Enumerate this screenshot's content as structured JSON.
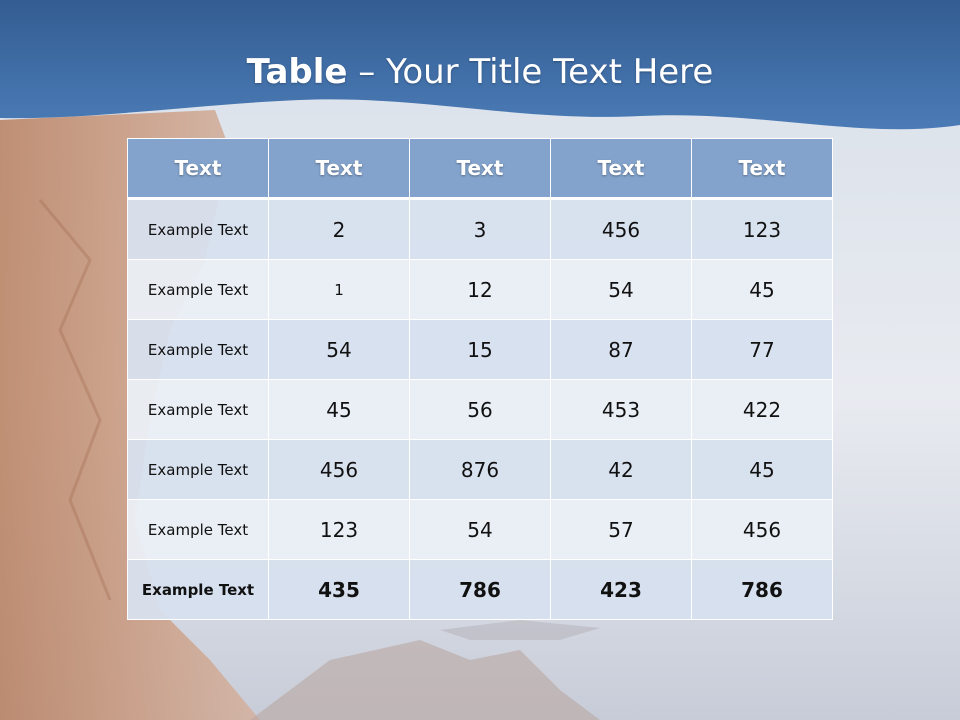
{
  "slide": {
    "title_bold": "Table",
    "title_rest": " – Your Title Text Here"
  },
  "table": {
    "headers": [
      "Text",
      "Text",
      "Text",
      "Text",
      "Text"
    ],
    "rows": [
      [
        "Example Text",
        "2",
        "3",
        "456",
        "123"
      ],
      [
        "Example Text",
        "1",
        "12",
        "54",
        "45"
      ],
      [
        "Example Text",
        "54",
        "15",
        "87",
        "77"
      ],
      [
        "Example Text",
        "45",
        "56",
        "453",
        "422"
      ],
      [
        "Example Text",
        "456",
        "876",
        "42",
        "45"
      ],
      [
        "Example Text",
        "123",
        "54",
        "57",
        "456"
      ],
      [
        "Example Text",
        "435",
        "786",
        "423",
        "786"
      ]
    ]
  },
  "colors": {
    "header_band": "#3f6ea8",
    "table_header": "#84a3cc",
    "row_odd": "#d7e0ee",
    "row_even": "#eaeff6"
  }
}
